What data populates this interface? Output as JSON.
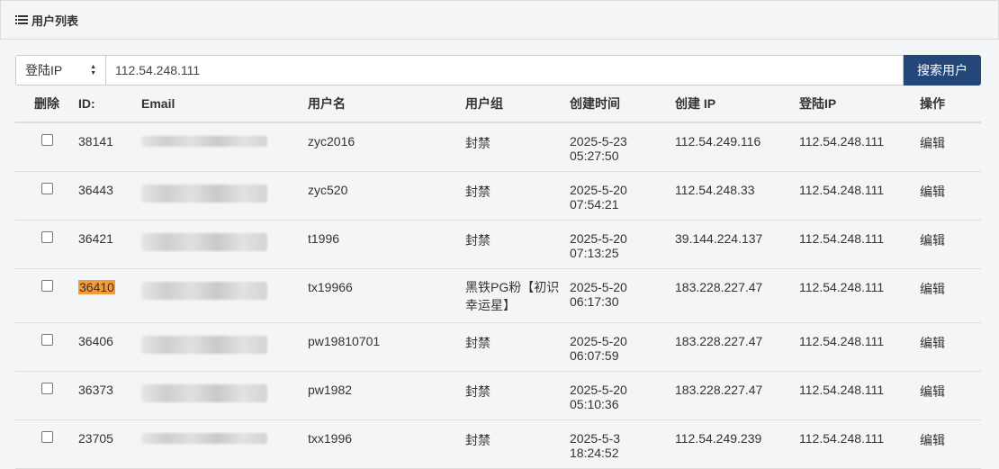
{
  "panel": {
    "title": "用户列表",
    "icon": "list-icon"
  },
  "search": {
    "field_label": "登陆IP",
    "value": "112.54.248.111",
    "button": "搜索用户"
  },
  "columns": [
    "删除",
    "ID:",
    "Email",
    "用户名",
    "用户组",
    "创建时间",
    "创建 IP",
    "登陆IP",
    "操作"
  ],
  "rows": [
    {
      "id": "38141",
      "name": "zyc2016",
      "group": "封禁",
      "date": "2025-5-23",
      "time": "05:27:50",
      "create_ip": "112.54.249.116",
      "login_ip": "112.54.248.111",
      "action": "编辑"
    },
    {
      "id": "36443",
      "name": "zyc520",
      "group": "封禁",
      "date": "2025-5-20",
      "time": "07:54:21",
      "create_ip": "112.54.248.33",
      "login_ip": "112.54.248.111",
      "action": "编辑"
    },
    {
      "id": "36421",
      "name": "t1996",
      "group": "封禁",
      "date": "2025-5-20",
      "time": "07:13:25",
      "create_ip": "39.144.224.137",
      "login_ip": "112.54.248.111",
      "action": "编辑"
    },
    {
      "id": "36410",
      "name": "tx19966",
      "group": "黑铁PG粉【初识幸运星】",
      "date": "2025-5-20",
      "time": "06:17:30",
      "create_ip": "183.228.227.47",
      "login_ip": "112.54.248.111",
      "action": "编辑"
    },
    {
      "id": "36406",
      "name": "pw19810701",
      "group": "封禁",
      "date": "2025-5-20",
      "time": "06:07:59",
      "create_ip": "183.228.227.47",
      "login_ip": "112.54.248.111",
      "action": "编辑"
    },
    {
      "id": "36373",
      "name": "pw1982",
      "group": "封禁",
      "date": "2025-5-20",
      "time": "05:10:36",
      "create_ip": "183.228.227.47",
      "login_ip": "112.54.248.111",
      "action": "编辑"
    },
    {
      "id": "23705",
      "name": "txx1996",
      "group": "封禁",
      "date": "2025-5-3",
      "time": "18:24:52",
      "create_ip": "112.54.249.239",
      "login_ip": "112.54.248.111",
      "action": "编辑"
    }
  ],
  "colors": {
    "accent": "#24477a",
    "highlight": "#f39c3c"
  }
}
